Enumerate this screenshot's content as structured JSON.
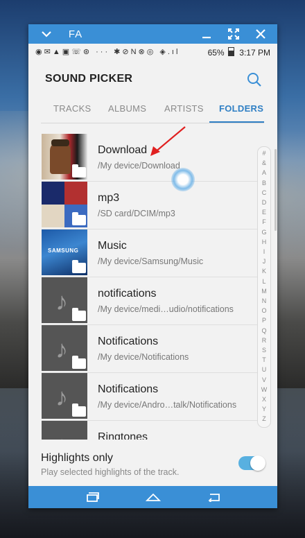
{
  "window": {
    "title_icons": [
      "chevron-down-icon",
      "fa-icon",
      "minimize-icon",
      "expand-icon",
      "close-icon"
    ],
    "fa_label": "FA"
  },
  "status_bar": {
    "battery": "65%",
    "time": "3:17 PM"
  },
  "header": {
    "title": "SOUND PICKER"
  },
  "tabs": [
    {
      "label": "TRACKS",
      "active": false
    },
    {
      "label": "ALBUMS",
      "active": false
    },
    {
      "label": "ARTISTS",
      "active": false
    },
    {
      "label": "FOLDERS",
      "active": true
    }
  ],
  "folders": [
    {
      "name": "Download",
      "path": "/My device/Download",
      "thumb": "album-art"
    },
    {
      "name": "mp3",
      "path": "/SD card/DCIM/mp3",
      "thumb": "album-art"
    },
    {
      "name": "Music",
      "path": "/My device/Samsung/Music",
      "thumb": "samsung-art",
      "thumb_text": "SAMSUNG"
    },
    {
      "name": "notifications",
      "path": "/My device/medi…udio/notifications",
      "thumb": "music-note-icon"
    },
    {
      "name": "Notifications",
      "path": "/My device/Notifications",
      "thumb": "music-note-icon"
    },
    {
      "name": "Notifications",
      "path": "/My device/Andro…talk/Notifications",
      "thumb": "music-note-icon"
    },
    {
      "name": "Ringtones",
      "path": "",
      "thumb": "music-note-icon"
    }
  ],
  "index_letters": [
    "#",
    "&",
    "A",
    "B",
    "C",
    "D",
    "E",
    "F",
    "G",
    "H",
    "I",
    "J",
    "K",
    "L",
    "M",
    "N",
    "O",
    "P",
    "Q",
    "R",
    "S",
    "T",
    "U",
    "V",
    "W",
    "X",
    "Y",
    "Z"
  ],
  "highlights": {
    "title": "Highlights only",
    "subtitle": "Play selected highlights of the track.",
    "enabled": true
  },
  "colors": {
    "accent": "#3a8fd6",
    "tab_active": "#2f7fc4",
    "toggle_on": "#58b0e0"
  }
}
